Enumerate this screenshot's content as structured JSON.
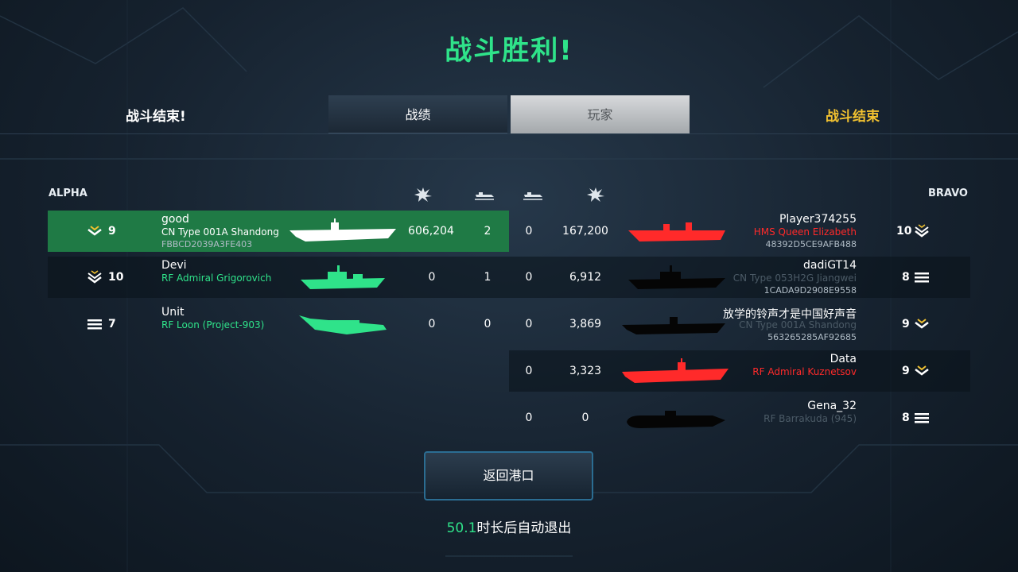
{
  "colors": {
    "accent": "#2fe38a",
    "gold": "#f2c230",
    "enemy_red": "#ff2a2a",
    "highlight_row": "#1f7a45",
    "ally_ship": "#2fe38a"
  },
  "header": {
    "title": "战斗胜利!",
    "left_status": "战斗结束!",
    "right_status": "战斗结束"
  },
  "tabs": [
    {
      "label": "战绩",
      "selected": false
    },
    {
      "label": "玩家",
      "selected": true
    }
  ],
  "teams": {
    "alpha": "ALPHA",
    "bravo": "BRAVO"
  },
  "column_icons": [
    "damage-icon",
    "kills-icon",
    "kills-icon",
    "damage-icon"
  ],
  "alpha": [
    {
      "rank": "9",
      "rank_icon": "chevron-rank-icon",
      "name": "good",
      "ship": "CN Type 001A Shandong",
      "id": "FBBCD2039A3FE403",
      "damage": "606,204",
      "kills": "2",
      "ship_icon": "aircraft-carrier-icon"
    },
    {
      "rank": "10",
      "rank_icon": "chevron-rank-icon",
      "name": "Devi",
      "ship": "RF Admiral Grigorovich",
      "id": "",
      "damage": "0",
      "kills": "1",
      "ship_icon": "frigate-icon"
    },
    {
      "rank": "7",
      "rank_icon": "bars-rank-icon",
      "name": "Unit",
      "ship": "RF Loon (Project-903)",
      "id": "",
      "damage": "0",
      "kills": "0",
      "ship_icon": "ekranoplan-icon"
    }
  ],
  "bravo": [
    {
      "rank": "10",
      "rank_icon": "chevron-rank-icon",
      "name": "Player374255",
      "ship": "HMS Queen Elizabeth",
      "id": "48392D5CE9AFB488",
      "kills": "0",
      "damage": "167,200",
      "ship_icon": "aircraft-carrier-icon"
    },
    {
      "rank": "8",
      "rank_icon": "bars-rank-icon",
      "name": "dadiGT14",
      "ship": "CN Type 053H2G Jiangwei",
      "id": "1CADA9D2908E9558",
      "kills": "0",
      "damage": "6,912",
      "ship_icon": "frigate-icon"
    },
    {
      "rank": "9",
      "rank_icon": "chevron-rank-icon",
      "name": "放学的铃声才是中国好声音",
      "ship": "CN Type 001A Shandong",
      "id": "563265285AF92685",
      "kills": "0",
      "damage": "3,869",
      "ship_icon": "aircraft-carrier-icon"
    },
    {
      "rank": "9",
      "rank_icon": "chevron-rank-icon",
      "name": "Data",
      "ship": "RF Admiral Kuznetsov",
      "id": "",
      "kills": "0",
      "damage": "3,323",
      "ship_icon": "aircraft-carrier-icon"
    },
    {
      "rank": "8",
      "rank_icon": "bars-rank-icon",
      "name": "Gena_32",
      "ship": "RF Barrakuda (945)",
      "id": "",
      "kills": "0",
      "damage": "0",
      "ship_icon": "submarine-icon"
    }
  ],
  "footer": {
    "return_button": "返回港口",
    "countdown": "50.1",
    "exit_text": "时长后自动退出"
  }
}
